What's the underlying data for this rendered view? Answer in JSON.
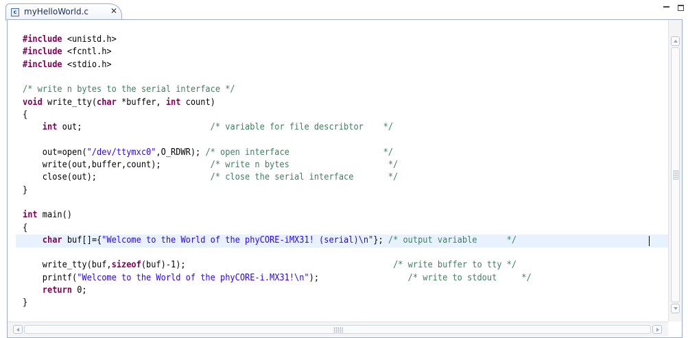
{
  "tab": {
    "label": "myHelloWorld.c",
    "icon": "c-source-file-icon",
    "close_glyph": "✕"
  },
  "colors": {
    "keyword": "#7f0055",
    "comment": "#3f7f5f",
    "string": "#2a00ff",
    "current_line": "#e8f2fe"
  },
  "editor": {
    "current_line": 14,
    "lines": [
      {
        "y": 0,
        "tokens": [
          [
            "kw",
            "#include"
          ],
          [
            "tx",
            " <unistd.h>"
          ]
        ]
      },
      {
        "y": 1,
        "tokens": [
          [
            "kw",
            "#include"
          ],
          [
            "tx",
            " <fcntl.h>"
          ]
        ]
      },
      {
        "y": 2,
        "tokens": [
          [
            "kw",
            "#include"
          ],
          [
            "tx",
            " <stdio.h>"
          ]
        ]
      },
      {
        "y": 3,
        "tokens": []
      },
      {
        "y": 4,
        "tokens": [
          [
            "cm",
            "/* write n bytes to the serial interface */"
          ]
        ]
      },
      {
        "y": 5,
        "tokens": [
          [
            "kw",
            "void"
          ],
          [
            "tx",
            " write_tty("
          ],
          [
            "kw",
            "char"
          ],
          [
            "tx",
            " *buffer, "
          ],
          [
            "kw",
            "int"
          ],
          [
            "tx",
            " count)"
          ]
        ]
      },
      {
        "y": 6,
        "tokens": [
          [
            "tx",
            "{"
          ]
        ]
      },
      {
        "y": 7,
        "tokens": [
          [
            "tx",
            "    "
          ],
          [
            "kw",
            "int"
          ],
          [
            "tx",
            " out;                          "
          ],
          [
            "cm",
            "/* variable for file describtor    */"
          ]
        ]
      },
      {
        "y": 8,
        "tokens": []
      },
      {
        "y": 9,
        "tokens": [
          [
            "tx",
            "    out=open("
          ],
          [
            "st",
            "\"/dev/ttymxc0\""
          ],
          [
            "tx",
            ",O_RDWR); "
          ],
          [
            "cm",
            "/* open interface                   */"
          ]
        ]
      },
      {
        "y": 10,
        "tokens": [
          [
            "tx",
            "    write(out,buffer,count);          "
          ],
          [
            "cm",
            "/* write n bytes                    */"
          ]
        ]
      },
      {
        "y": 11,
        "tokens": [
          [
            "tx",
            "    close(out);                       "
          ],
          [
            "cm",
            "/* close the serial interface       */"
          ]
        ]
      },
      {
        "y": 12,
        "tokens": [
          [
            "tx",
            "}"
          ]
        ]
      },
      {
        "y": 13,
        "tokens": []
      },
      {
        "y": 14,
        "tokens": [
          [
            "kw",
            "int"
          ],
          [
            "tx",
            " main()"
          ]
        ]
      },
      {
        "y": 15,
        "tokens": [
          [
            "tx",
            "{"
          ]
        ]
      },
      {
        "y": 16,
        "tokens": [
          [
            "tx",
            "    "
          ],
          [
            "kw",
            "char"
          ],
          [
            "tx",
            " buf[]={"
          ],
          [
            "st",
            "\"Welcome to the World of the phyCORE-iMX31! (serial)\\n\""
          ],
          [
            "tx",
            "}; "
          ],
          [
            "cm",
            "/* output variable      */"
          ]
        ]
      },
      {
        "y": 17,
        "tokens": []
      },
      {
        "y": 18,
        "tokens": [
          [
            "tx",
            "    write_tty(buf,"
          ],
          [
            "kw",
            "sizeof"
          ],
          [
            "tx",
            "(buf)-1);                                          "
          ],
          [
            "cm",
            "/* write buffer to tty */"
          ]
        ]
      },
      {
        "y": 19,
        "tokens": [
          [
            "tx",
            "    printf("
          ],
          [
            "st",
            "\"Welcome to the World of the phyCORE-i.MX31!\\n\""
          ],
          [
            "tx",
            ");                  "
          ],
          [
            "cm",
            "/* write to stdout     */"
          ]
        ]
      },
      {
        "y": 20,
        "tokens": [
          [
            "tx",
            "    "
          ],
          [
            "kw",
            "return"
          ],
          [
            "tx",
            " 0;"
          ]
        ]
      },
      {
        "y": 21,
        "tokens": [
          [
            "tx",
            "}"
          ]
        ]
      }
    ]
  }
}
